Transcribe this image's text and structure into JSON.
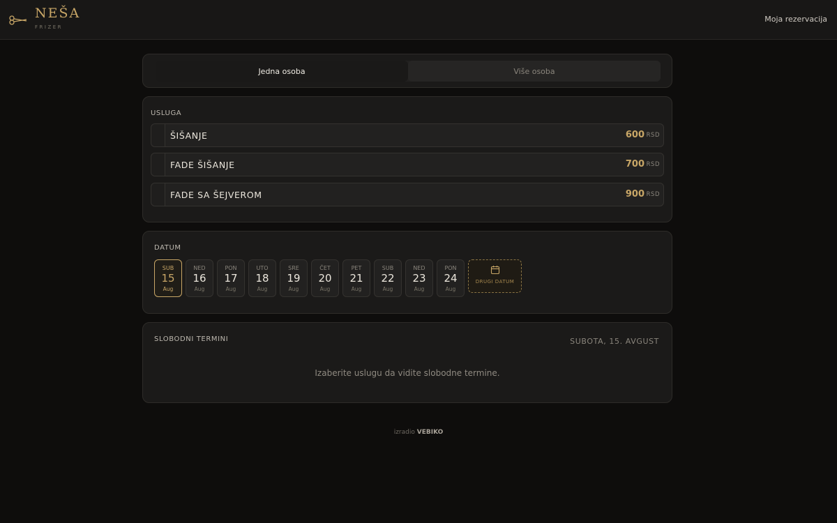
{
  "header": {
    "logo_name": "NEŠA",
    "logo_sub": "FRIZER",
    "logo_icon": "scissors-icon",
    "my_reservation": "Moja rezervacija"
  },
  "toggle": {
    "options": [
      "Jedna osoba",
      "Više osoba"
    ],
    "active": "Jedna osoba"
  },
  "services": {
    "label": "USLUGA",
    "items": [
      {
        "name": "ŠIŠANJE",
        "price": "600",
        "currency": "RSD"
      },
      {
        "name": "FADE ŠIŠANJE",
        "price": "700",
        "currency": "RSD"
      },
      {
        "name": "FADE SA ŠEJVEROM",
        "price": "900",
        "currency": "RSD"
      }
    ]
  },
  "date": {
    "label": "DATUM",
    "days": [
      {
        "dow": "SUB",
        "day": "15",
        "mon": "Aug",
        "selected": true
      },
      {
        "dow": "NED",
        "day": "16",
        "mon": "Aug"
      },
      {
        "dow": "PON",
        "day": "17",
        "mon": "Aug"
      },
      {
        "dow": "UTO",
        "day": "18",
        "mon": "Aug"
      },
      {
        "dow": "SRE",
        "day": "19",
        "mon": "Aug"
      },
      {
        "dow": "ČET",
        "day": "20",
        "mon": "Aug"
      },
      {
        "dow": "PET",
        "day": "21",
        "mon": "Aug"
      },
      {
        "dow": "SUB",
        "day": "22",
        "mon": "Aug"
      },
      {
        "dow": "NED",
        "day": "23",
        "mon": "Aug"
      },
      {
        "dow": "PON",
        "day": "24",
        "mon": "Aug"
      }
    ],
    "other_date": "DRUGI DATUM",
    "other_date_icon": "calendar-icon"
  },
  "slots": {
    "label": "SLOBODNI TERMINI",
    "selected_date": "SUBOTA, 15. AVGUST",
    "empty_message": "Izaberite uslugu da vidite slobodne termine."
  },
  "footer": {
    "made_by": "izradio",
    "brand": "VEBIKO"
  },
  "colors": {
    "accent": "#c9a767",
    "background": "#0e0d0c",
    "card": "#1b1a19"
  }
}
